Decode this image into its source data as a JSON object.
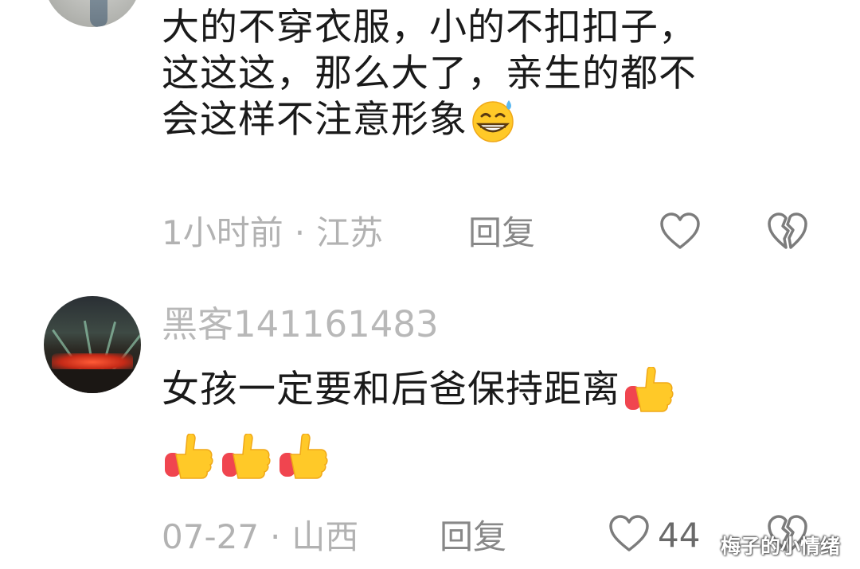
{
  "comments": [
    {
      "text_lines": [
        "大的不穿衣服，小的不扣扣子，",
        "这这这，那么大了，亲生的都不",
        "会这样不注意形象"
      ],
      "text_emoji": "grinning-sweat-emoji",
      "time": "1小时前",
      "separator": "·",
      "location": "江苏",
      "reply_label": "回复",
      "like_icon": "heart-outline-icon",
      "dislike_icon": "broken-heart-icon"
    },
    {
      "username": "黑客141161483",
      "text_lines": [
        "女孩一定要和后爸保持距离"
      ],
      "text_emoji": "thumbs-up-emoji",
      "text_emoji_count_line2": 3,
      "date": "07-27",
      "separator": "·",
      "location": "山西",
      "reply_label": "回复",
      "like_count": "44",
      "like_icon": "heart-outline-icon",
      "dislike_icon": "broken-heart-icon"
    }
  ],
  "watermark": "梅子的小情绪",
  "colors": {
    "text": "#1a1a1a",
    "meta": "#b2b2b2",
    "reply": "#888888",
    "icon": "#7c7c7c",
    "emoji_yellow": "#ffc928",
    "emoji_red": "#f0454f"
  }
}
